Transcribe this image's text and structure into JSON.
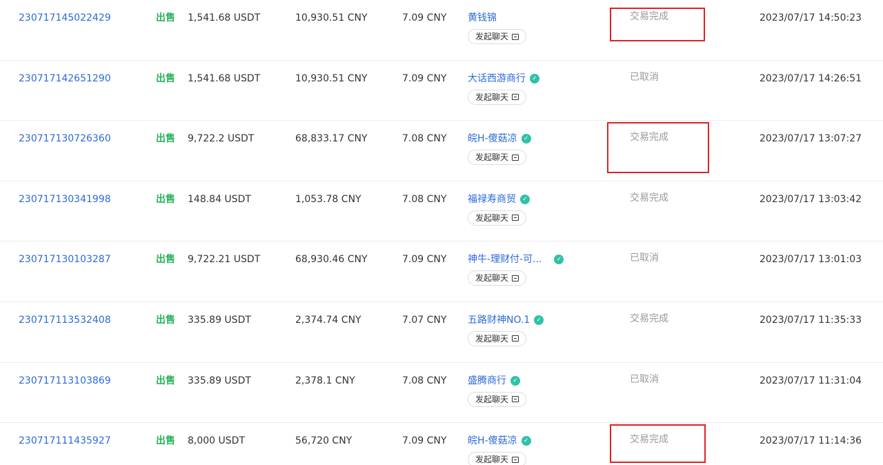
{
  "orders": [
    {
      "id": "230717145022429",
      "side": "出售",
      "amount": "1,541.68 USDT",
      "total": "10,930.51 CNY",
      "price": "7.09 CNY",
      "merchant": "黄钱锦",
      "verified": false,
      "chat_label": "发起聊天",
      "status": "交易完成",
      "time": "2023/07/17 14:50:23"
    },
    {
      "id": "230717142651290",
      "side": "出售",
      "amount": "1,541.68 USDT",
      "total": "10,930.51 CNY",
      "price": "7.09 CNY",
      "merchant": "大话西游商行",
      "verified": true,
      "chat_label": "发起聊天",
      "status": "已取消",
      "time": "2023/07/17 14:26:51"
    },
    {
      "id": "230717130726360",
      "side": "出售",
      "amount": "9,722.2 USDT",
      "total": "68,833.17 CNY",
      "price": "7.08 CNY",
      "merchant": "皖H-傻菇凉",
      "verified": true,
      "chat_label": "发起聊天",
      "status": "交易完成",
      "time": "2023/07/17 13:07:27"
    },
    {
      "id": "230717130341998",
      "side": "出售",
      "amount": "148.84 USDT",
      "total": "1,053.78 CNY",
      "price": "7.08 CNY",
      "merchant": "福禄寿商贸",
      "verified": true,
      "chat_label": "发起聊天",
      "status": "交易完成",
      "time": "2023/07/17 13:03:42"
    },
    {
      "id": "230717130103287",
      "side": "出售",
      "amount": "9,722.21 USDT",
      "total": "68,930.46 CNY",
      "price": "7.09 CNY",
      "merchant": "神牛-理财付-可...",
      "verified": true,
      "verified_far": true,
      "chat_label": "发起聊天",
      "status": "已取消",
      "time": "2023/07/17 13:01:03"
    },
    {
      "id": "230717113532408",
      "side": "出售",
      "amount": "335.89 USDT",
      "total": "2,374.74 CNY",
      "price": "7.07 CNY",
      "merchant": "五路财神NO.1",
      "verified": true,
      "chat_label": "发起聊天",
      "status": "交易完成",
      "time": "2023/07/17 11:35:33"
    },
    {
      "id": "230717113103869",
      "side": "出售",
      "amount": "335.89 USDT",
      "total": "2,378.1 CNY",
      "price": "7.08 CNY",
      "merchant": "盛腾商行",
      "verified": true,
      "chat_label": "发起聊天",
      "status": "已取消",
      "time": "2023/07/17 11:31:04"
    },
    {
      "id": "230717111435927",
      "side": "出售",
      "amount": "8,000 USDT",
      "total": "56,720 CNY",
      "price": "7.09 CNY",
      "merchant": "皖H-傻菇凉",
      "verified": true,
      "chat_label": "发起聊天",
      "status": "交易完成",
      "time": "2023/07/17 11:14:36"
    }
  ],
  "icons": {
    "verified": "verified-badge-icon",
    "chat": "chat-icon"
  },
  "colors": {
    "link": "#2b6ad8",
    "sell": "#27b35a",
    "status": "#999999",
    "highlight": "#e02020"
  }
}
